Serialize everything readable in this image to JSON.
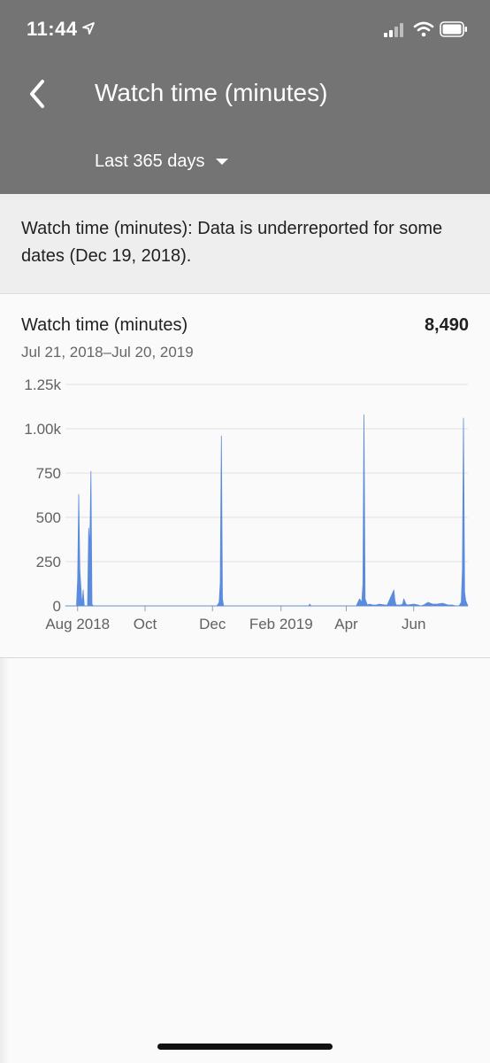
{
  "status_bar": {
    "time": "11:44"
  },
  "header": {
    "title": "Watch time (minutes)",
    "range": "Last 365 days"
  },
  "notice": {
    "text": "Watch time (minutes): Data is underreported for some dates (Dec 19, 2018)."
  },
  "card": {
    "metric_label": "Watch time (minutes)",
    "metric_value": "8,490",
    "date_range": "Jul 21, 2018–Jul 20, 2019"
  },
  "colors": {
    "header_bg": "#747474",
    "series": "#5b8bdc",
    "grid": "#e0e0e0"
  },
  "icons": [
    "back-arrow-icon",
    "location-arrow-icon",
    "signal-icon",
    "wifi-icon",
    "battery-icon",
    "dropdown-caret-icon"
  ],
  "chart_data": {
    "type": "area",
    "title": "",
    "xlabel": "",
    "ylabel": "",
    "ylim": [
      0,
      1250
    ],
    "yticks": [
      0,
      250,
      500,
      750,
      1000,
      1250
    ],
    "ytick_labels": [
      "0",
      "250",
      "500",
      "750",
      "1.00k",
      "1.25k"
    ],
    "xlim": [
      "2018-07-21",
      "2019-07-20"
    ],
    "xticks": [
      "2018-08-01",
      "2018-10-01",
      "2018-12-01",
      "2019-02-01",
      "2019-04-01",
      "2019-06-01"
    ],
    "xtick_labels": [
      "Aug 2018",
      "Oct",
      "Dec",
      "Feb 2019",
      "Apr",
      "Jun"
    ],
    "grid": true,
    "series": [
      {
        "x": [
          "2018-07-21",
          "2018-07-30",
          "2018-07-31",
          "2018-08-01",
          "2018-08-02",
          "2018-08-03",
          "2018-08-05",
          "2018-08-06",
          "2018-08-07",
          "2018-08-08",
          "2018-08-10",
          "2018-08-11",
          "2018-08-12",
          "2018-08-13",
          "2018-08-14",
          "2018-08-15",
          "2018-08-17",
          "2018-08-20",
          "2018-09-10",
          "2018-10-01",
          "2018-11-01",
          "2018-12-05",
          "2018-12-07",
          "2018-12-08",
          "2018-12-09",
          "2018-12-10",
          "2018-12-11",
          "2018-12-13",
          "2019-01-15",
          "2019-02-26",
          "2019-02-27",
          "2019-02-28",
          "2019-04-10",
          "2019-04-13",
          "2019-04-15",
          "2019-04-16",
          "2019-04-17",
          "2019-04-18",
          "2019-04-20",
          "2019-04-22",
          "2019-04-25",
          "2019-04-28",
          "2019-05-01",
          "2019-05-06",
          "2019-05-08",
          "2019-05-14",
          "2019-05-15",
          "2019-05-16",
          "2019-05-20",
          "2019-05-22",
          "2019-05-23",
          "2019-05-24",
          "2019-05-25",
          "2019-05-26",
          "2019-06-01",
          "2019-06-05",
          "2019-06-07",
          "2019-06-10",
          "2019-06-14",
          "2019-06-18",
          "2019-06-22",
          "2019-06-27",
          "2019-07-02",
          "2019-07-06",
          "2019-07-09",
          "2019-07-12",
          "2019-07-14",
          "2019-07-15",
          "2019-07-16",
          "2019-07-17",
          "2019-07-18",
          "2019-07-20"
        ],
        "y": [
          0,
          0,
          0,
          150,
          630,
          200,
          0,
          90,
          0,
          0,
          0,
          440,
          330,
          760,
          10,
          0,
          0,
          0,
          0,
          0,
          0,
          0,
          20,
          130,
          960,
          40,
          0,
          0,
          0,
          0,
          10,
          0,
          0,
          40,
          20,
          120,
          1080,
          40,
          5,
          10,
          5,
          5,
          10,
          5,
          5,
          90,
          30,
          5,
          5,
          10,
          40,
          25,
          10,
          5,
          10,
          5,
          0,
          5,
          20,
          10,
          10,
          15,
          5,
          5,
          0,
          0,
          20,
          200,
          1060,
          80,
          30,
          0
        ]
      }
    ]
  }
}
